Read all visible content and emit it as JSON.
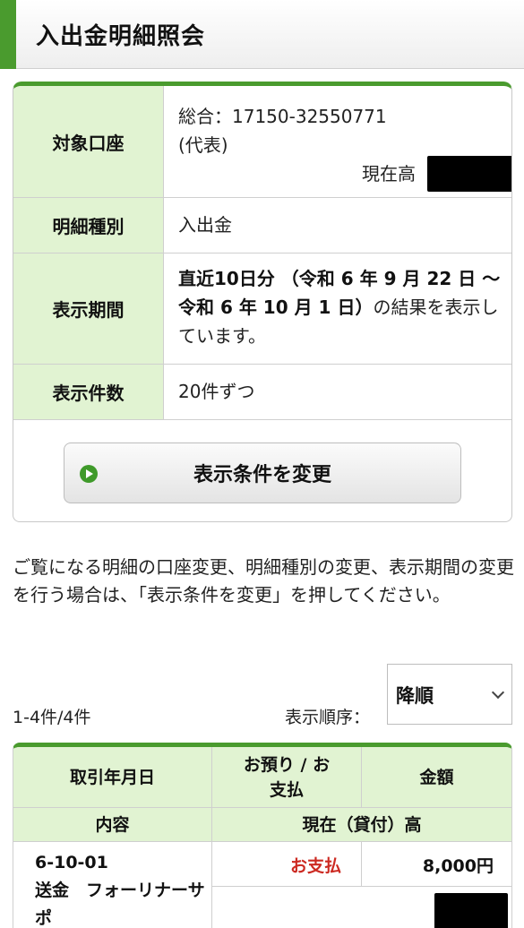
{
  "header": {
    "title": "入出金明細照会"
  },
  "conditions": {
    "account": {
      "label": "対象口座",
      "line1": "総合：17150-32550771",
      "line2": "(代表)",
      "balance_label": "現在高"
    },
    "type": {
      "label": "明細種別",
      "value": "入出金"
    },
    "period": {
      "label": "表示期間",
      "value_bold": "直近10日分 （令和 6 年 9 月 22 日 〜 令和 6 年 10 月 1 日）",
      "value_rest": "の結果を表示しています。"
    },
    "per_page": {
      "label": "表示件数",
      "value": "20件ずつ"
    },
    "change_button": "表示条件を変更"
  },
  "notice": "ご覧になる明細の口座変更、明細種別の変更、表示期間の変更を行う場合は、「表示条件を変更」を押してください。",
  "list": {
    "count": "1-4件/4件",
    "order_label": "表示順序：",
    "order_value": "降順"
  },
  "table": {
    "headers": {
      "date": "取引年月日",
      "kind": "お預り / お支払",
      "amount": "金額",
      "content": "内容",
      "balance": "現在（貸付）高"
    },
    "rows": [
      {
        "date": "6-10-01",
        "description": "送金　フォーリナーサポ",
        "kind": "お支払",
        "amount": "8,000円"
      }
    ]
  },
  "colors": {
    "accent": "#4a9b2e",
    "header_cell": "#e1f3d2",
    "payment": "#cc2a22"
  }
}
